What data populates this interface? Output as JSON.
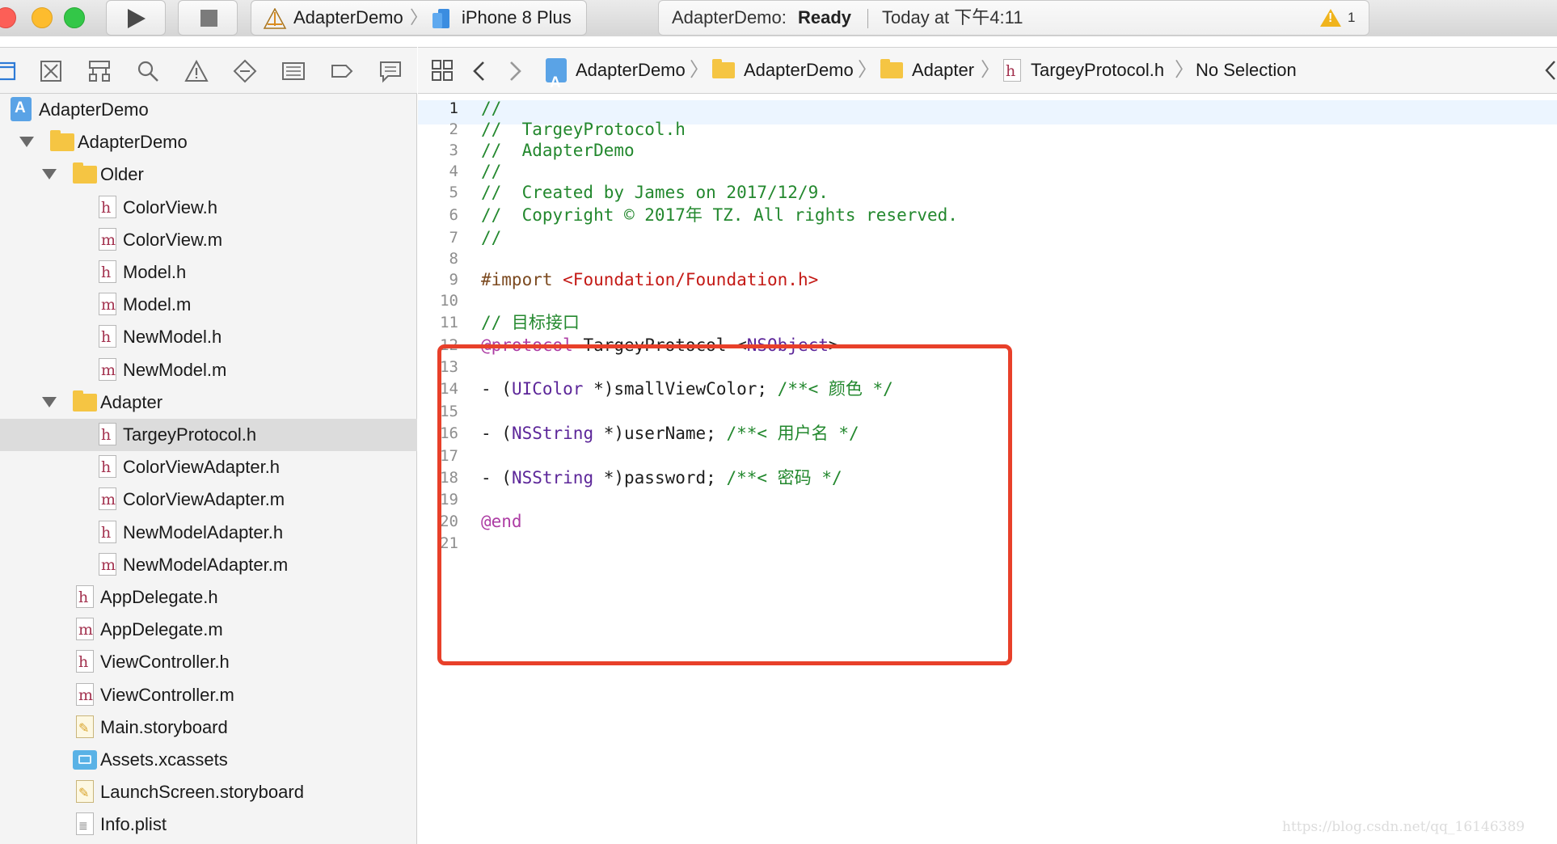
{
  "toolbar": {
    "scheme_name": "AdapterDemo",
    "scheme_separator": "〉",
    "device": "iPhone 8 Plus",
    "status_app": "AdapterDemo:",
    "status_state": "Ready",
    "status_time": "Today at 下午4:11",
    "warning_count": "1",
    "warning_glyph": "!"
  },
  "jumpbar": {
    "separator": "〉",
    "items": [
      {
        "label": "AdapterDemo",
        "icon": "project-icon"
      },
      {
        "label": "AdapterDemo",
        "icon": "folder-icon"
      },
      {
        "label": "Adapter",
        "icon": "folder-icon"
      },
      {
        "label": "TargeyProtocol.h",
        "icon": "header-file-icon"
      },
      {
        "label": "No Selection",
        "icon": ""
      }
    ]
  },
  "sidebar": {
    "items": [
      {
        "label": "AdapterDemo",
        "kind": "project",
        "depth": 0
      },
      {
        "label": "AdapterDemo",
        "kind": "folder",
        "depth": 1,
        "expanded": true
      },
      {
        "label": "Older",
        "kind": "folder",
        "depth": 2,
        "expanded": true
      },
      {
        "label": "ColorView.h",
        "kind": "h",
        "depth": 3
      },
      {
        "label": "ColorView.m",
        "kind": "m",
        "depth": 3
      },
      {
        "label": "Model.h",
        "kind": "h",
        "depth": 3
      },
      {
        "label": "Model.m",
        "kind": "m",
        "depth": 3
      },
      {
        "label": "NewModel.h",
        "kind": "h",
        "depth": 3
      },
      {
        "label": "NewModel.m",
        "kind": "m",
        "depth": 3
      },
      {
        "label": "Adapter",
        "kind": "folder",
        "depth": 2,
        "expanded": true
      },
      {
        "label": "TargeyProtocol.h",
        "kind": "h",
        "depth": 3,
        "selected": true
      },
      {
        "label": "ColorViewAdapter.h",
        "kind": "h",
        "depth": 3
      },
      {
        "label": "ColorViewAdapter.m",
        "kind": "m",
        "depth": 3
      },
      {
        "label": "NewModelAdapter.h",
        "kind": "h",
        "depth": 3
      },
      {
        "label": "NewModelAdapter.m",
        "kind": "m",
        "depth": 3
      },
      {
        "label": "AppDelegate.h",
        "kind": "h",
        "depth": 2
      },
      {
        "label": "AppDelegate.m",
        "kind": "m",
        "depth": 2
      },
      {
        "label": "ViewController.h",
        "kind": "h",
        "depth": 2
      },
      {
        "label": "ViewController.m",
        "kind": "m",
        "depth": 2
      },
      {
        "label": "Main.storyboard",
        "kind": "storyboard",
        "depth": 2
      },
      {
        "label": "Assets.xcassets",
        "kind": "assets",
        "depth": 2
      },
      {
        "label": "LaunchScreen.storyboard",
        "kind": "storyboard",
        "depth": 2
      },
      {
        "label": "Info.plist",
        "kind": "plist",
        "depth": 2
      }
    ]
  },
  "editor": {
    "current_line": 1,
    "lines": [
      [
        [
          "com",
          "//"
        ]
      ],
      [
        [
          "com",
          "//  TargeyProtocol.h"
        ]
      ],
      [
        [
          "com",
          "//  AdapterDemo"
        ]
      ],
      [
        [
          "com",
          "//"
        ]
      ],
      [
        [
          "com",
          "//  Created by James on 2017/12/9."
        ]
      ],
      [
        [
          "com",
          "//  Copyright © 2017年 TZ. All rights reserved."
        ]
      ],
      [
        [
          "com",
          "//"
        ]
      ],
      [],
      [
        [
          "pre",
          "#import "
        ],
        [
          "str",
          "<Foundation/Foundation.h>"
        ]
      ],
      [],
      [
        [
          "com",
          "// 目标接口"
        ]
      ],
      [
        [
          "kw",
          "@protocol"
        ],
        [
          "pl",
          " TargeyProtocol <"
        ],
        [
          "typ",
          "NSObject"
        ],
        [
          "pl",
          ">"
        ]
      ],
      [],
      [
        [
          "pl",
          "- ("
        ],
        [
          "typ",
          "UIColor"
        ],
        [
          "pl",
          " *)smallViewColor; "
        ],
        [
          "com",
          "/**< 颜色 */"
        ]
      ],
      [],
      [
        [
          "pl",
          "- ("
        ],
        [
          "typ",
          "NSString"
        ],
        [
          "pl",
          " *)userName; "
        ],
        [
          "com",
          "/**< 用户名 */"
        ]
      ],
      [],
      [
        [
          "pl",
          "- ("
        ],
        [
          "typ",
          "NSString"
        ],
        [
          "pl",
          " *)password; "
        ],
        [
          "com",
          "/**< 密码 */"
        ]
      ],
      [],
      [
        [
          "kw",
          "@end"
        ]
      ],
      []
    ]
  },
  "watermark": "https://blog.csdn.net/qq_16146389",
  "colors": {
    "annotation_box": "#e8402a",
    "comment": "#23882e",
    "keyword": "#ad3da4",
    "type": "#5c2699",
    "string": "#c41a16"
  }
}
